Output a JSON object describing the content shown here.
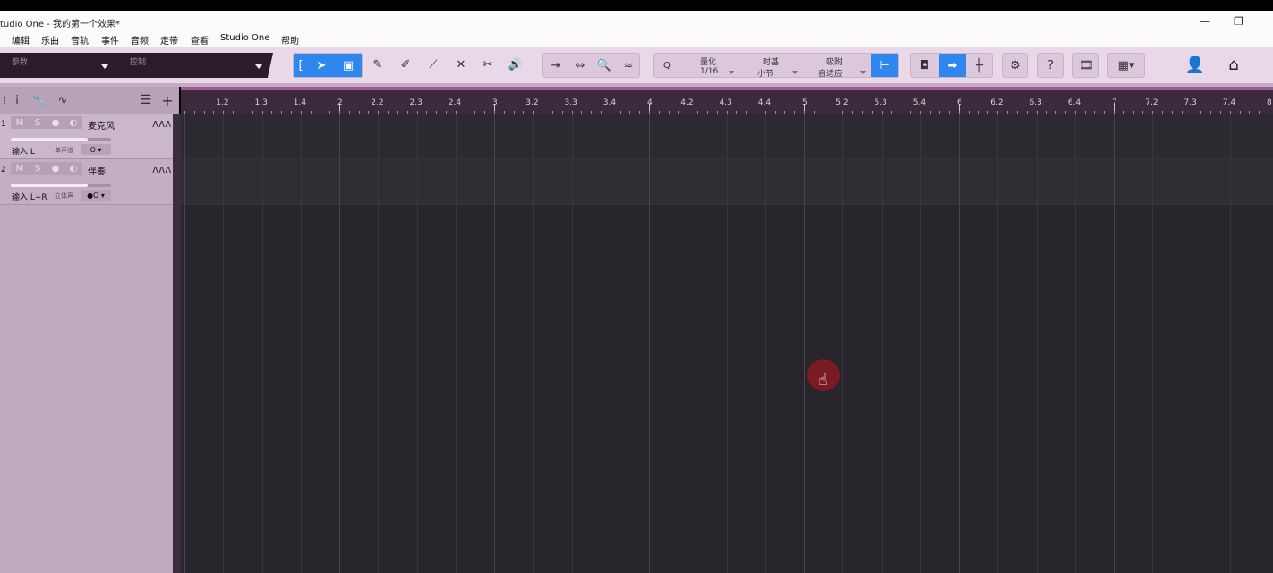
{
  "window": {
    "title": "tudio One - 我的第一个效果*",
    "controls": [
      "—",
      "❐"
    ]
  },
  "menu": [
    "编辑",
    "乐曲",
    "音轨",
    "事件",
    "音频",
    "走带",
    "查看",
    "Studio One",
    "帮助"
  ],
  "panel": {
    "params_label": "参数",
    "control_label": "控制"
  },
  "toolbar": {
    "iq_label": "IQ",
    "quantize": {
      "label": "量化",
      "value": "1/16"
    },
    "timebase": {
      "label": "时基",
      "value": "小节"
    },
    "snap": {
      "label": "吸附",
      "value": "自适应"
    },
    "help_label": "?"
  },
  "tracks": [
    {
      "num": "1",
      "mute": "M",
      "solo": "S",
      "name": "麦克风",
      "input": "输入 L",
      "mode": "单声道",
      "monitor": "O",
      "volume": 0.77
    },
    {
      "num": "2",
      "mute": "M",
      "solo": "S",
      "name": "伴奏",
      "input": "输入 L+R",
      "mode": "立体声",
      "monitor": "●O",
      "volume": 0.77
    }
  ],
  "ruler_labels": [
    "1.2",
    "1.3",
    "1.4",
    "2",
    "2.2",
    "2.3",
    "2.4",
    "3",
    "3.2",
    "3.3",
    "3.4",
    "4",
    "4.2",
    "4.3",
    "4.4",
    "5",
    "5.2",
    "5.3",
    "5.4",
    "6",
    "6.2",
    "6.3",
    "6.4",
    "7",
    "7.2",
    "7.3",
    "7.4",
    "8"
  ],
  "colors": {
    "accent": "#2f86ee",
    "ruler_bg": "#3b2a3b",
    "arrange_bg": "#28252c",
    "track_panel": "#c0aac0"
  }
}
